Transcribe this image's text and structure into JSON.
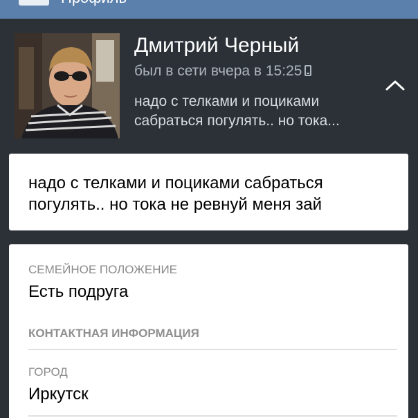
{
  "topbar": {
    "title_fragment": "Профиль"
  },
  "profile": {
    "name": "Дмитрий Черный",
    "online_status": "был в сети вчера в 15:25",
    "device_icon": "phone-icon",
    "status_preview_line1": "надо с телками и поциками",
    "status_preview_line2": "сабраться погулять.. но тока..."
  },
  "status": {
    "text": "надо с телками и поциками сабраться погулять.. но тока не ревнуй меня зай"
  },
  "info": {
    "relationship_label": "СЕМЕЙНОЕ ПОЛОЖЕНИЕ",
    "relationship_value": "Есть подруга",
    "contact_section": "КОНТАКТНАЯ ИНФОРМАЦИЯ",
    "city_label": "ГОРОД",
    "city_value": "Иркутск"
  },
  "colors": {
    "background": "#2b3137",
    "topbar": "#5b80ab",
    "card": "#ffffff",
    "secondary_text": "#aeb5bd"
  }
}
